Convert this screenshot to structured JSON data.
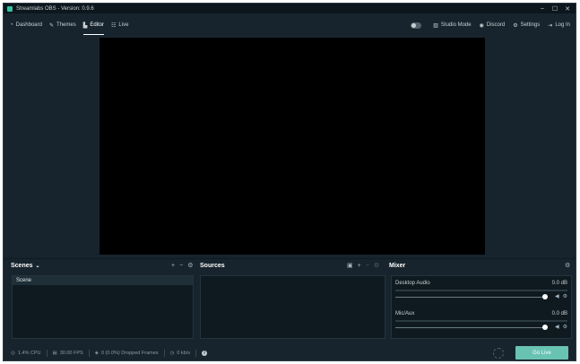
{
  "window": {
    "title": "Streamlabs OBS - Version: 0.9.6",
    "controls": [
      "–",
      "☐",
      "✕"
    ]
  },
  "nav": {
    "left": [
      {
        "label": "Dashboard",
        "icon": "dashboard-icon",
        "glyph": "◔"
      },
      {
        "label": "Themes",
        "icon": "themes-icon",
        "glyph": "✎"
      },
      {
        "label": "Editor",
        "icon": "editor-icon",
        "glyph": "▙",
        "active": true
      },
      {
        "label": "Live",
        "icon": "live-icon",
        "glyph": "☷"
      }
    ],
    "right": [
      {
        "label": "Studio Mode",
        "icon": "studio-mode-icon",
        "glyph": "▥"
      },
      {
        "label": "Discord",
        "icon": "discord-icon",
        "glyph": "◉"
      },
      {
        "label": "Settings",
        "icon": "gear-icon",
        "glyph": "⚙"
      },
      {
        "label": "Log In",
        "icon": "login-icon",
        "glyph": "⇥"
      }
    ]
  },
  "scenes": {
    "title": "Scenes",
    "items": [
      "Scene"
    ]
  },
  "sources": {
    "title": "Sources"
  },
  "mixer": {
    "title": "Mixer",
    "channels": [
      {
        "name": "Desktop Audio",
        "level": "0.0 dB",
        "volume": 1.0
      },
      {
        "name": "Mic/Aux",
        "level": "0.0 dB",
        "volume": 1.0
      }
    ]
  },
  "footer": {
    "cpu": "1.4% CPU",
    "fps": "30.00 FPS",
    "dropped": "0 (0.0%) Dropped Frames",
    "bitrate": "0 kb/s",
    "go_live": "Go Live"
  },
  "colors": {
    "background": "#17242d",
    "accent": "#69c3b3",
    "preview": "#000000"
  }
}
